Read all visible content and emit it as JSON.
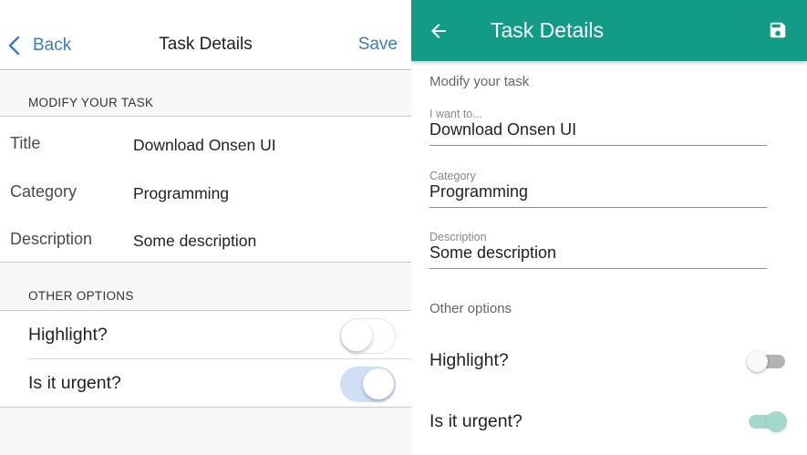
{
  "colors": {
    "ios_accent": "#3f7bbf",
    "ios_switch_on_track": "#cfe0f5",
    "md_toolbar": "#129c86",
    "md_switch_on": "#a3d8cd"
  },
  "ios": {
    "nav": {
      "back_label": "Back",
      "back_icon": "chevron-left-icon",
      "title": "Task Details",
      "save_label": "Save"
    },
    "modify_header": "MODIFY YOUR TASK",
    "fields": [
      {
        "label": "Title",
        "value": "Download Onsen UI"
      },
      {
        "label": "Category",
        "value": "Programming"
      },
      {
        "label": "Description",
        "value": "Some description"
      }
    ],
    "options_header": "OTHER OPTIONS",
    "options": [
      {
        "label": "Highlight?",
        "checked": false
      },
      {
        "label": "Is it urgent?",
        "checked": true
      }
    ]
  },
  "md": {
    "toolbar": {
      "back_icon": "arrow-back-icon",
      "title": "Task Details",
      "save_icon": "floppy-disk-icon"
    },
    "modify_header": "Modify your task",
    "fields": [
      {
        "label": "I want to...",
        "value": "Download Onsen UI"
      },
      {
        "label": "Category",
        "value": "Programming"
      },
      {
        "label": "Description",
        "value": "Some description"
      }
    ],
    "options_header": "Other options",
    "options": [
      {
        "label": "Highlight?",
        "checked": false
      },
      {
        "label": "Is it urgent?",
        "checked": true
      }
    ]
  }
}
